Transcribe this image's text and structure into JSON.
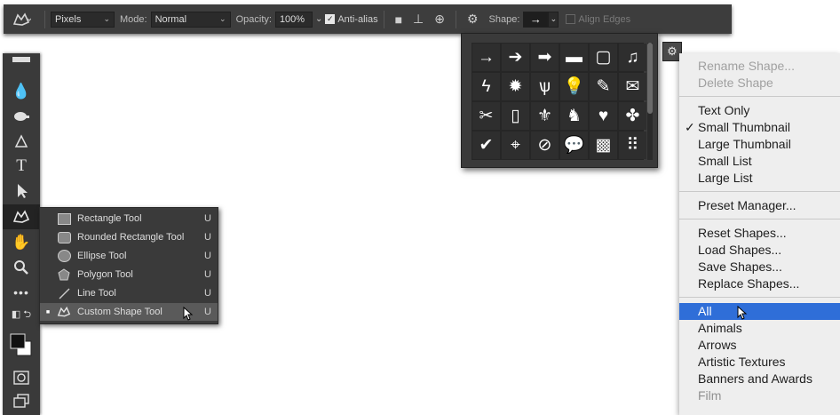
{
  "options_bar": {
    "tool_icon": "custom-shape-icon",
    "mode_select": "Pixels",
    "mode_label": "Mode:",
    "blend_mode": "Normal",
    "opacity_label": "Opacity:",
    "opacity_value": "100%",
    "antialias_label": "Anti-alias",
    "antialias_checked": true,
    "shape_label": "Shape:",
    "shape_value": "arrow",
    "align_edges_label": "Align Edges",
    "align_edges_checked": false
  },
  "toolbar": {
    "tools": [
      {
        "icon": "blur-drop-icon"
      },
      {
        "icon": "dodge-icon"
      },
      {
        "icon": "pen-icon"
      },
      {
        "icon": "type-icon",
        "glyph": "T"
      },
      {
        "icon": "path-selection-icon"
      },
      {
        "icon": "custom-shape-icon",
        "active": true
      },
      {
        "icon": "hand-icon"
      },
      {
        "icon": "zoom-icon"
      },
      {
        "icon": "more-icon"
      },
      {
        "icon": "swap-colors-icon"
      },
      {
        "icon": "color-swatches-icon"
      },
      {
        "icon": "quick-mask-icon"
      },
      {
        "icon": "screen-mode-icon"
      }
    ]
  },
  "flyout": {
    "items": [
      {
        "label": "Rectangle Tool",
        "shortcut": "U",
        "icon": "rectangle-icon"
      },
      {
        "label": "Rounded Rectangle Tool",
        "shortcut": "U",
        "icon": "rounded-rectangle-icon"
      },
      {
        "label": "Ellipse Tool",
        "shortcut": "U",
        "icon": "ellipse-icon"
      },
      {
        "label": "Polygon Tool",
        "shortcut": "U",
        "icon": "polygon-icon"
      },
      {
        "label": "Line Tool",
        "shortcut": "U",
        "icon": "line-icon"
      },
      {
        "label": "Custom Shape Tool",
        "shortcut": "U",
        "icon": "custom-shape-icon",
        "selected": true
      }
    ]
  },
  "shape_picker": {
    "shapes": [
      {
        "name": "arrow-thin",
        "glyph": "→"
      },
      {
        "name": "arrow-bold",
        "glyph": "➔"
      },
      {
        "name": "arrow-heavy",
        "glyph": "➡"
      },
      {
        "name": "banner",
        "glyph": "▬"
      },
      {
        "name": "frame",
        "glyph": "▢"
      },
      {
        "name": "music-note",
        "glyph": "♫"
      },
      {
        "name": "lightning",
        "glyph": "ϟ"
      },
      {
        "name": "starburst",
        "glyph": "✹"
      },
      {
        "name": "grass",
        "glyph": "ѱ"
      },
      {
        "name": "lightbulb",
        "glyph": "💡"
      },
      {
        "name": "pin",
        "glyph": "✎"
      },
      {
        "name": "envelope",
        "glyph": "✉"
      },
      {
        "name": "scissors",
        "glyph": "✂"
      },
      {
        "name": "stamp",
        "glyph": "▯"
      },
      {
        "name": "fleur-de-lis",
        "glyph": "⚜"
      },
      {
        "name": "cat",
        "glyph": "♞"
      },
      {
        "name": "heart",
        "glyph": "♥"
      },
      {
        "name": "puzzle",
        "glyph": "✤"
      },
      {
        "name": "checkmark",
        "glyph": "✔"
      },
      {
        "name": "crosshair",
        "glyph": "⌖"
      },
      {
        "name": "no-sign",
        "glyph": "⊘"
      },
      {
        "name": "speech-bubble",
        "glyph": "💬"
      },
      {
        "name": "grid-texture",
        "glyph": "▩"
      },
      {
        "name": "dots",
        "glyph": "⠿"
      }
    ]
  },
  "menu": {
    "items": [
      {
        "label": "Rename Shape...",
        "disabled": true
      },
      {
        "label": "Delete Shape",
        "disabled": true
      },
      {
        "divider": true
      },
      {
        "label": "Text Only"
      },
      {
        "label": "Small Thumbnail",
        "checked": true
      },
      {
        "label": "Large Thumbnail"
      },
      {
        "label": "Small List"
      },
      {
        "label": "Large List"
      },
      {
        "divider": true
      },
      {
        "label": "Preset Manager..."
      },
      {
        "divider": true
      },
      {
        "label": "Reset Shapes..."
      },
      {
        "label": "Load Shapes..."
      },
      {
        "label": "Save Shapes..."
      },
      {
        "label": "Replace Shapes..."
      },
      {
        "divider": true
      },
      {
        "label": "All",
        "highlighted": true
      },
      {
        "label": "Animals"
      },
      {
        "label": "Arrows"
      },
      {
        "label": "Artistic Textures"
      },
      {
        "label": "Banners and Awards"
      },
      {
        "label": "Film",
        "partial": true
      }
    ]
  },
  "colors": {
    "menu_highlight": "#2f6ed8",
    "panel_bg": "#3a3a3a"
  }
}
